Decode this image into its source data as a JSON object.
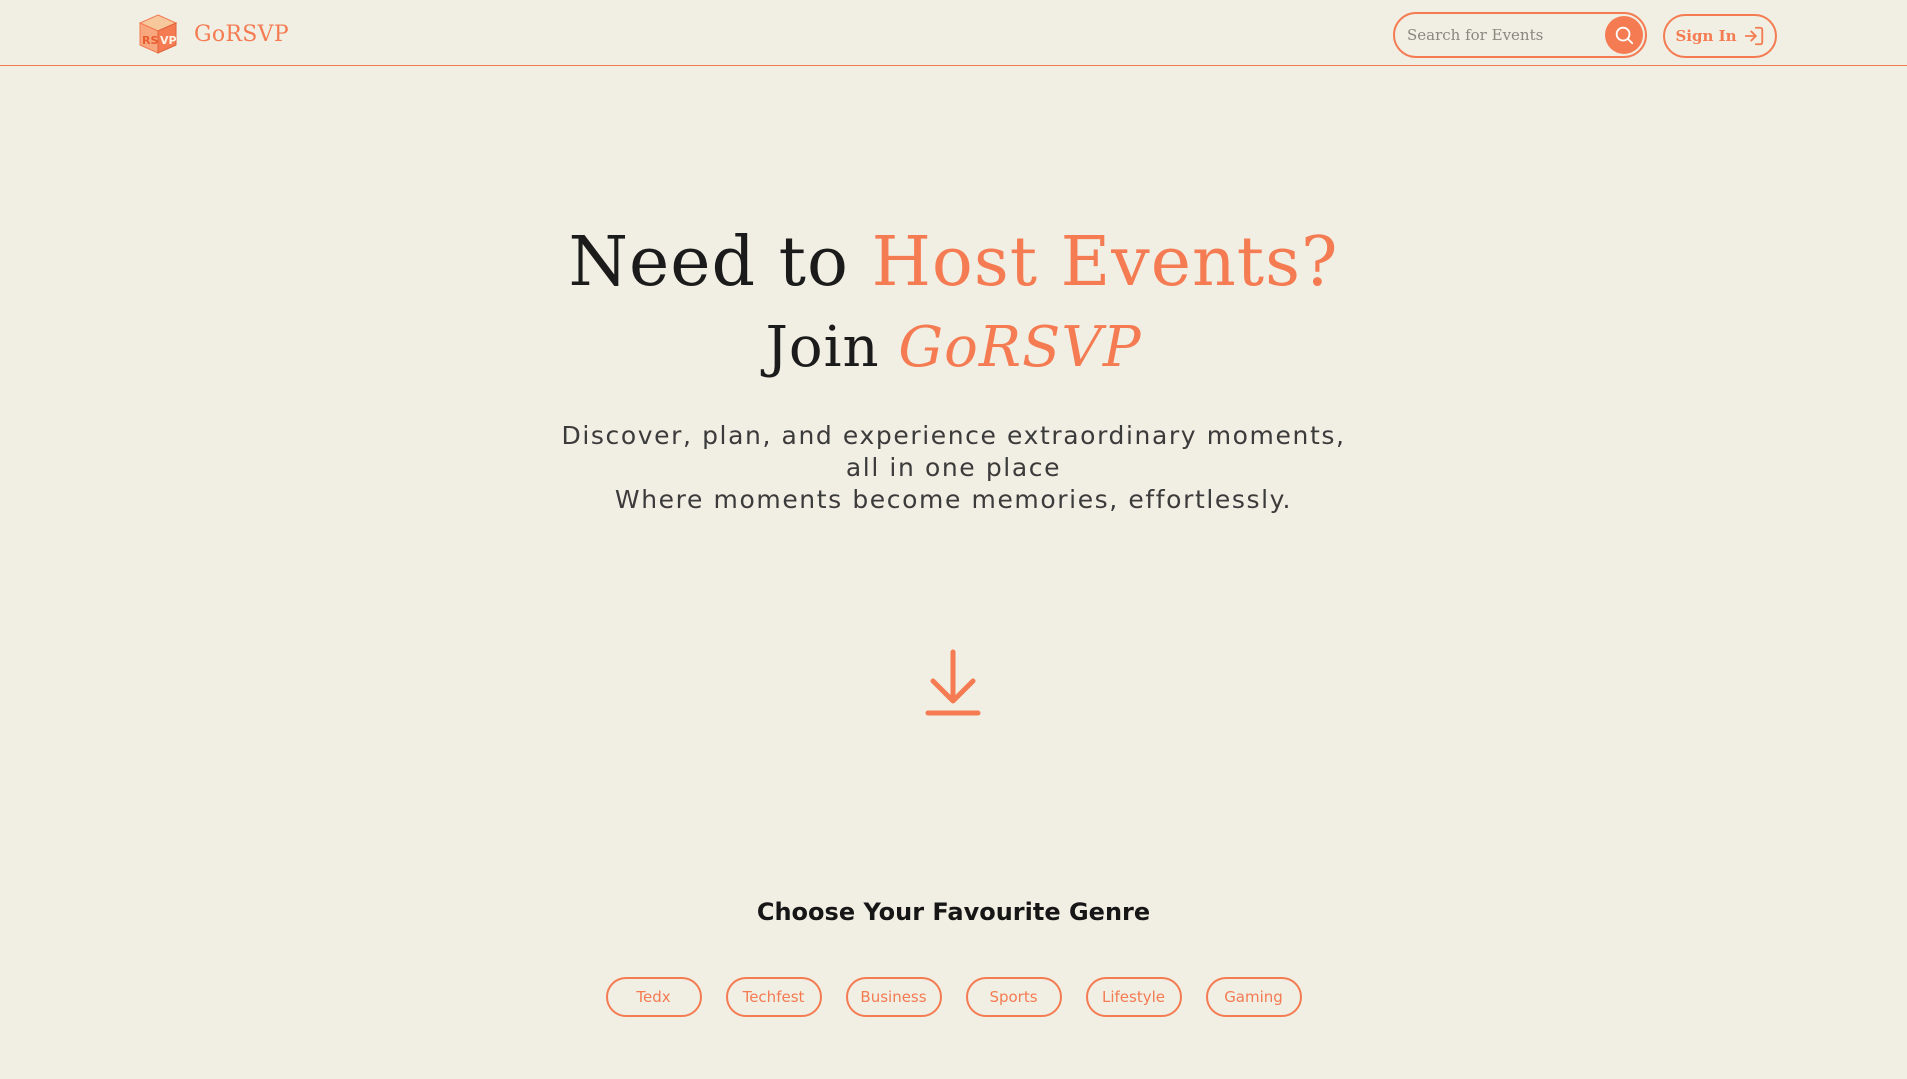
{
  "colors": {
    "accent": "#f47b52",
    "background": "#f1eee3",
    "text_dark": "#1b1b1b"
  },
  "header": {
    "brand_name": "GoRSVP",
    "logo_icon": "rsvp-cube-logo",
    "search": {
      "placeholder": "Search for Events",
      "value": "",
      "button_icon": "search-icon"
    },
    "signin": {
      "label": "Sign In",
      "icon": "sign-in-arrow-icon"
    }
  },
  "hero": {
    "line1_plain": "Need to",
    "line1_accent": "Host Events?",
    "line2_plain": "Join",
    "line2_accent": "GoRSVP",
    "subtitle_lines": [
      "Discover, plan, and experience extraordinary moments,",
      "all in one place",
      "Where moments become memories, effortlessly."
    ],
    "scroll_icon": "download-arrow-icon"
  },
  "genres": {
    "title": "Choose Your Favourite Genre",
    "items": [
      "Tedx",
      "Techfest",
      "Business",
      "Sports",
      "Lifestyle",
      "Gaming"
    ]
  }
}
